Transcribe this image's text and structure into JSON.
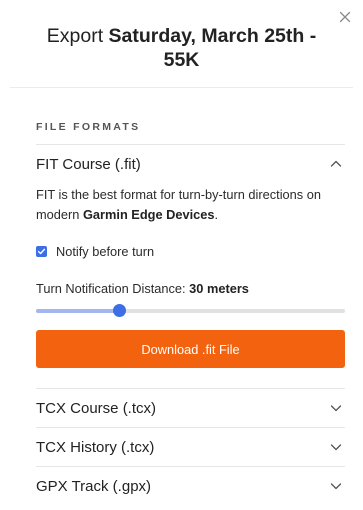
{
  "dialog": {
    "title_prefix": "Export ",
    "title_bold": "Saturday, March 25th - 55K"
  },
  "section": {
    "label": "FILE FORMATS"
  },
  "formats": {
    "fit": {
      "label": "FIT Course (.fit)",
      "expanded": true,
      "description_pre": "FIT is the best format for turn-by-turn directions on modern ",
      "description_bold": "Garmin Edge Devices",
      "description_post": ".",
      "notify_label": "Notify before turn",
      "notify_checked": true,
      "distance_label": "Turn Notification Distance: ",
      "distance_value": "30 meters",
      "slider_fraction": 0.27,
      "download_label": "Download .fit File"
    },
    "others": [
      {
        "label": "TCX Course (.tcx)"
      },
      {
        "label": "TCX History (.tcx)"
      },
      {
        "label": "GPX Track (.gpx)"
      }
    ]
  },
  "colors": {
    "accent_blue": "#3d6ee6",
    "download_orange": "#f2620f"
  },
  "icons": {
    "close": "close-icon",
    "expanded": "chevron-up-icon",
    "collapsed": "chevron-down-icon",
    "check": "check-icon"
  }
}
